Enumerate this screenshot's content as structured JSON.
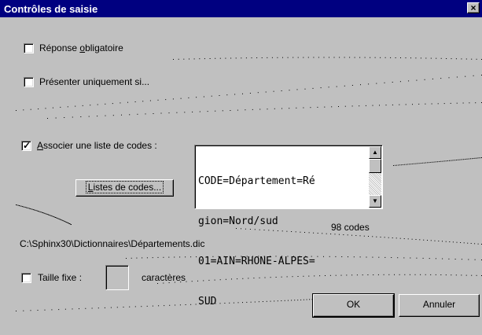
{
  "window": {
    "title": "Contrôles de saisie",
    "close_glyph": "×"
  },
  "required": {
    "label_before": "Réponse ",
    "label_accel": "o",
    "label_after": "bligatoire",
    "checked": false
  },
  "conditional": {
    "label": "Présenter uniquement si...",
    "checked": false
  },
  "code_list": {
    "label_accel": "A",
    "label_after": "ssocier une liste de codes :",
    "checked": true,
    "check_glyph": "✓",
    "button_accel": "L",
    "button_after": "istes de codes...",
    "lines": [
      "CODE=Département=Ré",
      "gion=Nord/sud",
      "01=AIN=RHONE-ALPES=",
      "SUD"
    ],
    "count_text": "98 codes",
    "file_path": "C:\\Sphinx30\\Dictionnaires\\Départements.dic",
    "scroll_up_glyph": "▲",
    "scroll_down_glyph": "▼"
  },
  "fixed_size": {
    "label": "Taille fixe :",
    "checked": false,
    "value": "",
    "unit": "caractères"
  },
  "buttons": {
    "ok": "OK",
    "cancel": "Annuler"
  }
}
